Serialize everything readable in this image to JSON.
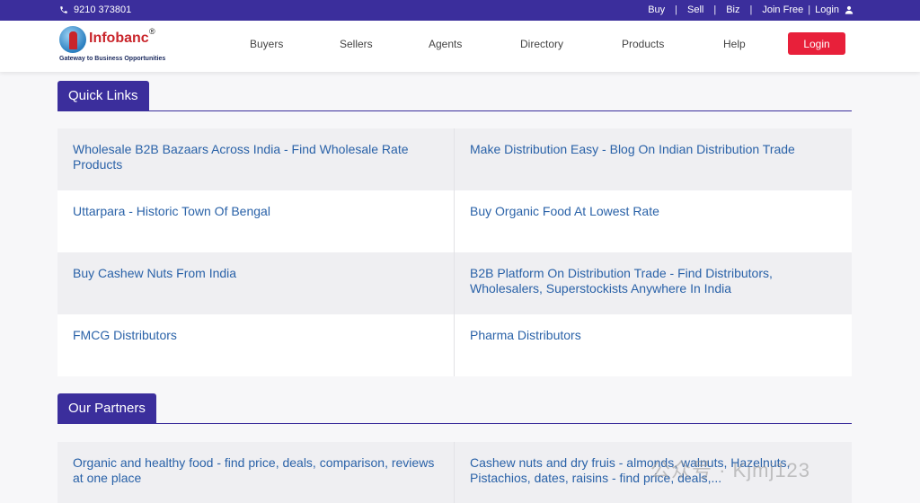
{
  "topbar": {
    "phone": "9210 373801",
    "links": [
      "Buy",
      "Sell",
      "Biz",
      "Join Free",
      "Login"
    ]
  },
  "header": {
    "logo_text": "Infobanc",
    "logo_reg": "®",
    "logo_tagline": "Gateway to Business Opportunities",
    "nav": [
      "Buyers",
      "Sellers",
      "Agents",
      "Directory",
      "Products",
      "Help"
    ],
    "login_button": "Login"
  },
  "quick_links": {
    "title": "Quick Links",
    "items": [
      "Wholesale B2B Bazaars Across India - Find Wholesale Rate Products",
      "Make Distribution Easy - Blog On Indian Distribution Trade",
      "Uttarpara - Historic Town Of Bengal",
      "Buy Organic Food At Lowest Rate",
      "Buy Cashew Nuts From India",
      "B2B Platform On Distribution Trade - Find Distributors, Wholesalers, Superstockists Anywhere In India",
      "FMCG Distributors",
      "Pharma Distributors"
    ]
  },
  "partners": {
    "title": "Our Partners",
    "items": [
      "Organic and healthy food - find price, deals, comparison, reviews at one place",
      "Cashew nuts and dry fruis - almonds, walnuts, Hazelnuts, Pistachios, dates, raisins - find price, deals,..."
    ]
  },
  "watermark": "公众号 · Kjmj123",
  "colors": {
    "brand": "#3b2e9c",
    "login": "#e8203a",
    "link": "#2a62a8"
  }
}
